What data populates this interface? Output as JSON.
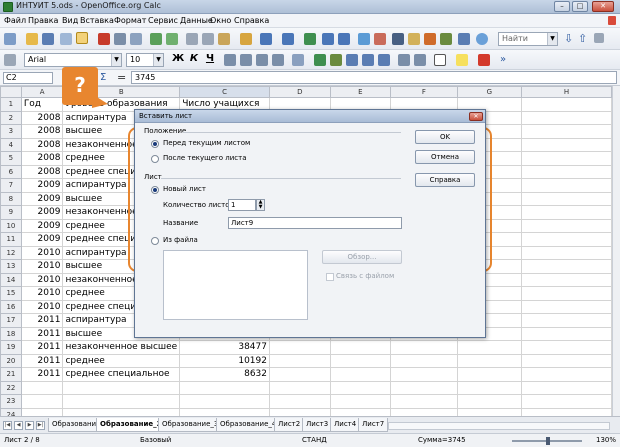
{
  "window": {
    "title": "ИНТУИТ 5.ods - OpenOffice.org Calc"
  },
  "menu": [
    "Файл",
    "Правка",
    "Вид",
    "Вставка",
    "Формат",
    "Сервис",
    "Данные",
    "Окно",
    "Справка"
  ],
  "toolbar": {
    "search_placeholder": "Найти",
    "font_name": "Arial",
    "font_size": "10"
  },
  "formula_bar": {
    "cell_ref": "C2",
    "sum_symbol": "Σ",
    "equals_symbol": "=",
    "value": "3745"
  },
  "sheet": {
    "columns": [
      "A",
      "B",
      "C",
      "D",
      "E",
      "F",
      "G",
      "H"
    ],
    "rows": [
      [
        "Год",
        "Уровень образования",
        "Число учащихся"
      ],
      [
        "2008",
        "аспирантура",
        ""
      ],
      [
        "2008",
        "высшее",
        ""
      ],
      [
        "2008",
        "незаконченное",
        ""
      ],
      [
        "2008",
        "среднее",
        ""
      ],
      [
        "2008",
        "среднее специа",
        ""
      ],
      [
        "2009",
        "аспирантура",
        ""
      ],
      [
        "2009",
        "высшее",
        ""
      ],
      [
        "2009",
        "незаконченное",
        ""
      ],
      [
        "2009",
        "среднее",
        ""
      ],
      [
        "2009",
        "среднее специа",
        ""
      ],
      [
        "2010",
        "аспирантура",
        ""
      ],
      [
        "2010",
        "высшее",
        ""
      ],
      [
        "2010",
        "незаконченное",
        ""
      ],
      [
        "2010",
        "среднее",
        ""
      ],
      [
        "2010",
        "среднее специа",
        ""
      ],
      [
        "2011",
        "аспирантура",
        ""
      ],
      [
        "2011",
        "высшее",
        ""
      ],
      [
        "2011",
        "незаконченное высшее",
        "38477"
      ],
      [
        "2011",
        "среднее",
        "10192"
      ],
      [
        "2011",
        "среднее специальное",
        "8632"
      ],
      [
        "",
        "",
        ""
      ],
      [
        "",
        "",
        ""
      ],
      [
        "",
        "",
        ""
      ]
    ]
  },
  "dialog": {
    "title": "Вставить лист",
    "position_label": "Положение",
    "before_current": "Перед текущим листом",
    "after_current": "После текущего листа",
    "sheet_label": "Лист",
    "new_sheet": "Новый лист",
    "count_label": "Количество листов",
    "count_value": "1",
    "name_label": "Название",
    "name_value": "Лист9",
    "from_file": "Из файла",
    "browse": "Обзор...",
    "link": "Связь с файлом",
    "ok": "OK",
    "cancel": "Отмена",
    "help": "Справка"
  },
  "help_badge": "?",
  "tabs": [
    "Образование",
    "Образование_2",
    "Образование_3",
    "Образование_4",
    "Лист2",
    "Лист3",
    "Лист4",
    "Лист7"
  ],
  "status": {
    "sheet": "Лист 2 / 8",
    "style": "Базовый",
    "mode": "СТАНД",
    "sum": "Сумма=3745",
    "zoom": "130%"
  },
  "colors": {
    "accent": "#e8862f",
    "titlebar": "#b7c7dd"
  }
}
